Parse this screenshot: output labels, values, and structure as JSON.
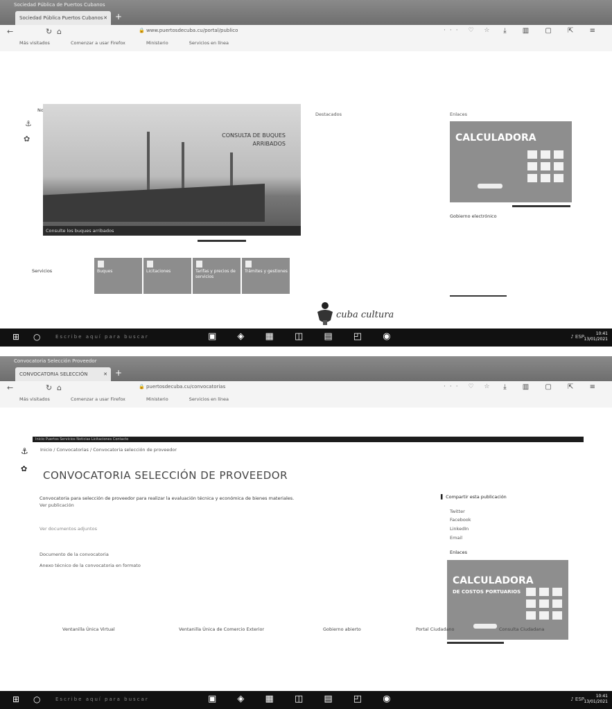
{
  "colors": {
    "taskbar": "#111111",
    "tabbar": "#7a7a7a",
    "calc_bg": "#8e8e8e",
    "tile_bg": "#8d8d8d"
  },
  "shot1": {
    "window_title": "Sociedad Pública de Puertos Cubanos",
    "tab_label": "Sociedad Pública Puertos Cubanos",
    "url": "www.puertosdecuba.cu/portal/publico",
    "bookmarks": [
      "Más visitados",
      "Comenzar a usar Firefox",
      "Ministerio",
      "Servicios en línea"
    ],
    "section_noticias": "Noticias",
    "section_destacados": "Destacados",
    "section_enlaces": "Enlaces",
    "slider_title_line1": "CONSULTA DE BUQUES",
    "slider_title_line2": "ARRIBADOS",
    "slider_caption": "Consulte los buques arribados",
    "calc_word": "CALCULADORA",
    "gob_link": "Gobierno electrónico",
    "section_servicios": "Servicios",
    "tiles": [
      "Buques",
      "Licitaciones",
      "Tarifas y precios de servicios",
      "Trámites y gestiones"
    ],
    "footer_text": "cuba cultura"
  },
  "shot2": {
    "window_title": "Convocatoria Selección Proveedor",
    "tab_label": "CONVOCATORIA SELECCIÓN",
    "url": "puertosdecuba.cu/convocatorias",
    "bookmarks": [
      "Más visitados",
      "Comenzar a usar Firefox",
      "Ministerio",
      "Servicios en línea"
    ],
    "headband": "Inicio   Puertos   Servicios   Noticias   Licitaciones   Contacto",
    "breadcrumb": "Inicio / Convocatorias / Convocatoria selección de proveedor",
    "title": "CONVOCATORIA SELECCIÓN DE PROVEEDOR",
    "body_line1": "Convocatoria para selección de proveedor para realizar la evaluación técnica y económica de bienes materiales.",
    "body_line2": "Ver publicación",
    "meta_line": "Ver documentos adjuntos",
    "doc_link_1": "Documento de la convocatoria",
    "doc_link_2": "Anexo técnico de la convocatoria en formato",
    "share_title": "Compartir esta publicación",
    "share_items": [
      "Twitter",
      "Facebook",
      "LinkedIn",
      "Email"
    ],
    "enlaces": "Enlaces",
    "calc_word": "CALCULADORA",
    "calc_sub": "DE COSTOS PORTUARIOS",
    "footer_links": [
      "Ventanilla Única Virtual",
      "Ventanilla Única de Comercio Exterior",
      "Gobierno abierto",
      "Portal Ciudadano",
      "Consulta Ciudadana"
    ]
  },
  "taskbar": {
    "search_placeholder": "Escribe aquí para buscar",
    "lang": "ESP",
    "time": "10:41",
    "date": "13/01/2021"
  }
}
